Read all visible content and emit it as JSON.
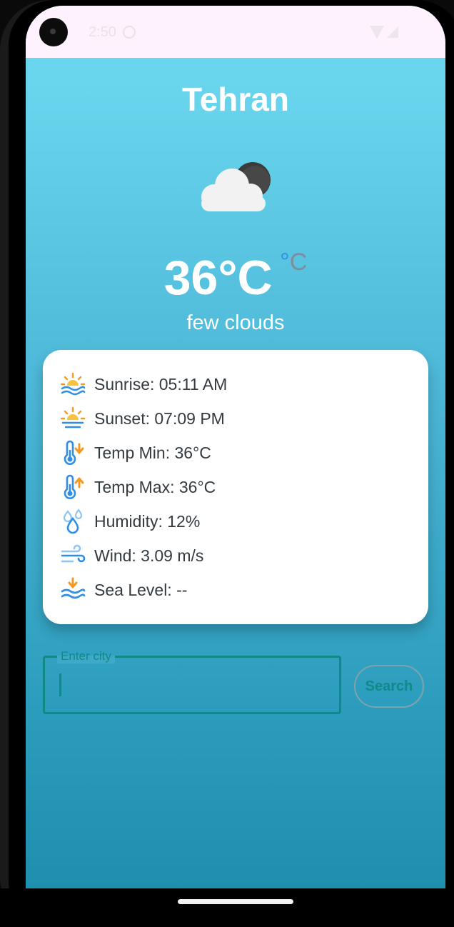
{
  "status_bar": {
    "time": "2:50"
  },
  "weather": {
    "city": "Tehran",
    "icon": "cloud-moon-icon",
    "temperature": "36°C",
    "unit_degree": "°",
    "unit_letter": "C",
    "description": "few clouds"
  },
  "details": [
    {
      "icon": "sunrise-icon",
      "text": "Sunrise: 05:11 AM"
    },
    {
      "icon": "sunset-icon",
      "text": "Sunset: 07:09 PM"
    },
    {
      "icon": "thermometer-down-icon",
      "text": "Temp Min: 36°C"
    },
    {
      "icon": "thermometer-up-icon",
      "text": "Temp Max: 36°C"
    },
    {
      "icon": "humidity-icon",
      "text": "Humidity: 12%"
    },
    {
      "icon": "wind-icon",
      "text": "Wind: 3.09 m/s"
    },
    {
      "icon": "sea-level-icon",
      "text": "Sea Level: --"
    }
  ],
  "search": {
    "label": "Enter city",
    "value": "",
    "button_label": "Search"
  },
  "colors": {
    "accent": "#0f8a86",
    "gradient_top": "#6ad6ee",
    "gradient_bottom": "#1f8fb0",
    "card": "#ffffff",
    "icon_orange": "#f39a24",
    "icon_blue": "#2f8ee8"
  }
}
